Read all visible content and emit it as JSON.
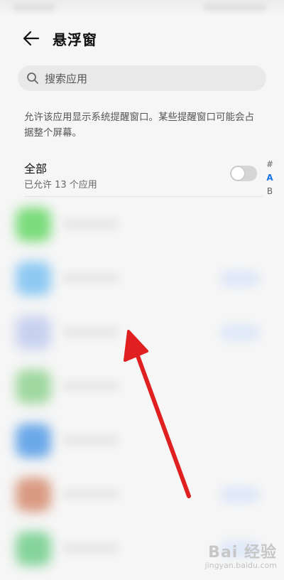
{
  "header": {
    "title": "悬浮窗"
  },
  "search": {
    "placeholder": "搜索应用"
  },
  "description": "允许该应用显示系统提醒窗口。某些提醒窗口可能会占据整个屏幕。",
  "all_apps": {
    "label": "全部",
    "subtitle": "已允许 13 个应用",
    "toggle_on": false
  },
  "index_bar": {
    "letters": [
      "#",
      "A",
      "B"
    ],
    "active": "A"
  },
  "apps": [
    {
      "icon_color": "#7bdc7b",
      "switch_visible": false
    },
    {
      "icon_color": "#8ec9f2",
      "switch_visible": true
    },
    {
      "icon_color": "#c8d2ef",
      "switch_visible": true
    },
    {
      "icon_color": "#9fd89f",
      "switch_visible": false
    },
    {
      "icon_color": "#6aa8e8",
      "switch_visible": false
    },
    {
      "icon_color": "#d99a82",
      "switch_visible": true
    },
    {
      "icon_color": "#84d39a",
      "switch_visible": true
    }
  ],
  "colors": {
    "accent": "#1a73e8",
    "arrow": "#e02020"
  },
  "watermark": {
    "logo": "Bai 经验",
    "url": "jingyan.baidu.com"
  }
}
